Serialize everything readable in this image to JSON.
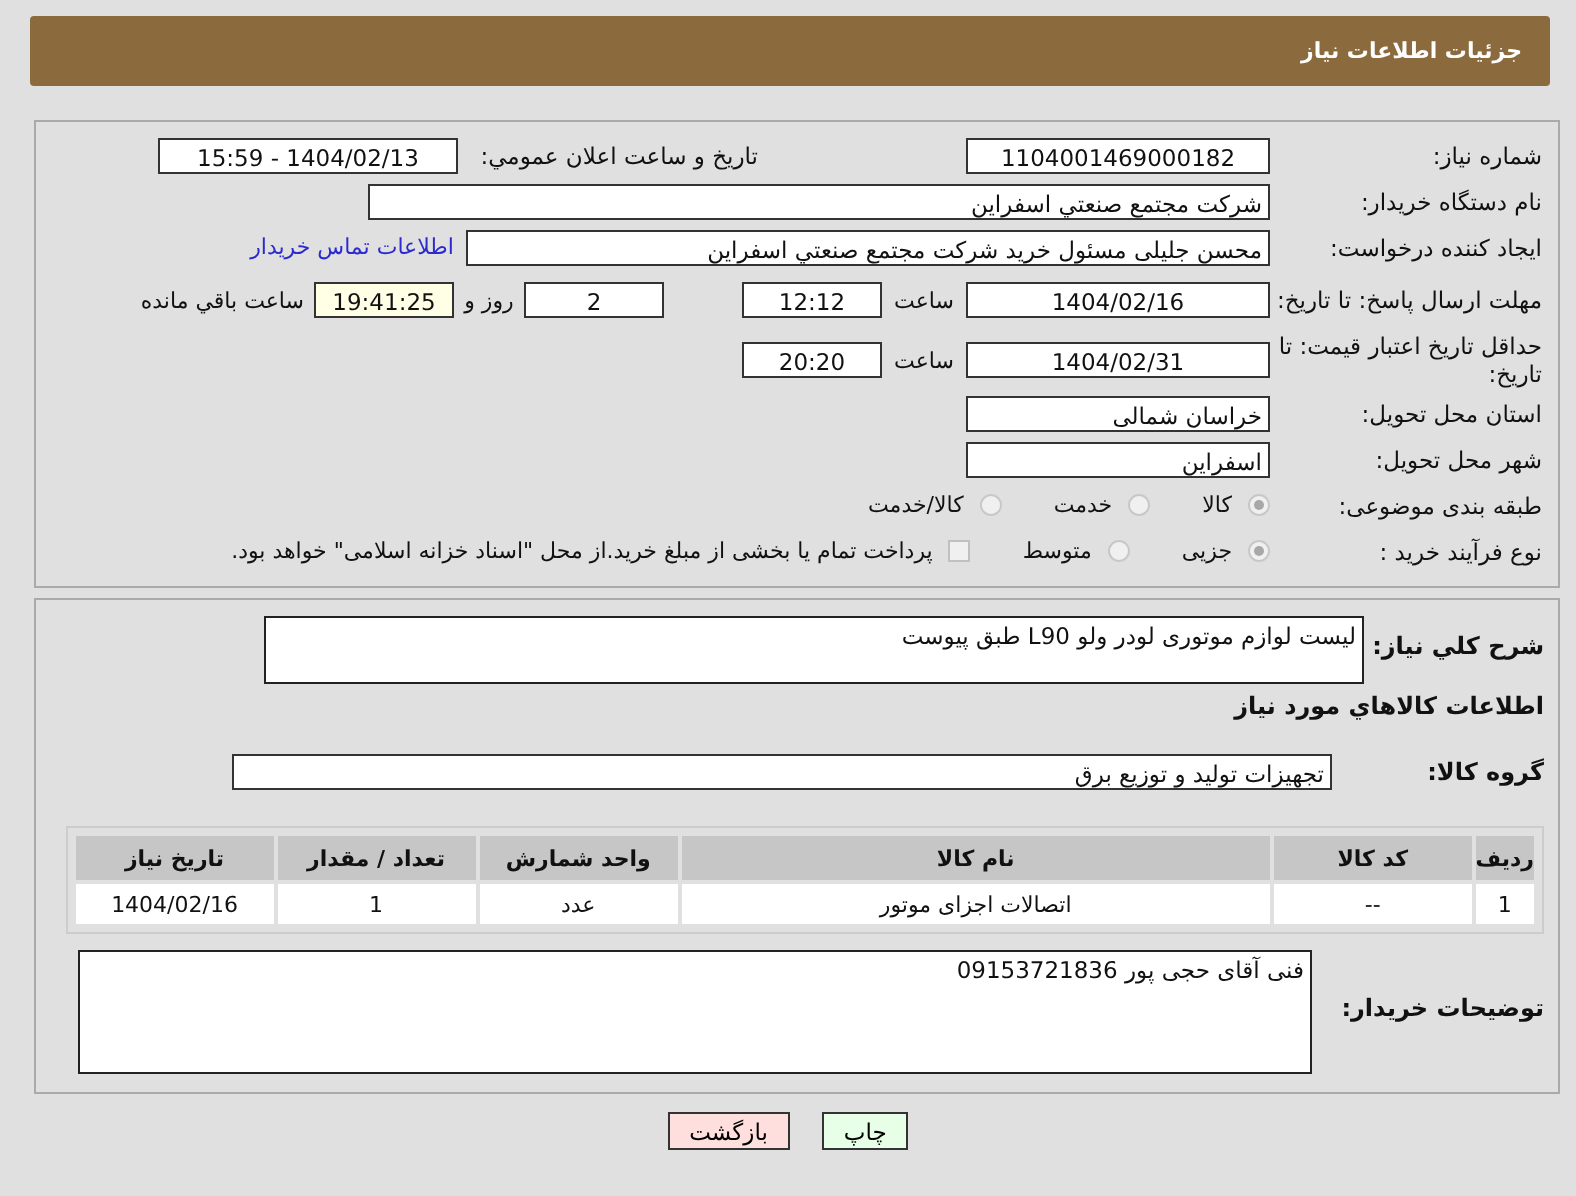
{
  "header": {
    "title": "جزئیات اطلاعات نیاز"
  },
  "need_number": {
    "label": "شماره نیاز:",
    "value": "1104001469000182"
  },
  "announce": {
    "label": "تاریخ و ساعت اعلان عمومي:",
    "value": "1404/02/13 - 15:59"
  },
  "buyer": {
    "label": "نام دستگاه خریدار:",
    "value": "شرکت مجتمع صنعتي اسفراین"
  },
  "requester": {
    "label": "ایجاد کننده درخواست:",
    "value": "محسن جلیلی مسئول خرید شرکت مجتمع صنعتي اسفراین",
    "link": "اطلاعات تماس خریدار"
  },
  "deadline": {
    "label": "مهلت ارسال پاسخ: تا تاریخ:",
    "date": "1404/02/16",
    "time_label": "ساعت",
    "time": "12:12",
    "days": "2",
    "days_label": "روز و",
    "remaining": "19:41:25",
    "remaining_label": "ساعت باقي مانده"
  },
  "validity": {
    "label": "حداقل تاریخ اعتبار قیمت: تا تاریخ:",
    "date": "1404/02/31",
    "time_label": "ساعت",
    "time": "20:20"
  },
  "province": {
    "label": "استان محل تحویل:",
    "value": "خراسان شمالی"
  },
  "city": {
    "label": "شهر محل تحویل:",
    "value": "اسفراین"
  },
  "category": {
    "label": "طبقه بندی موضوعی:",
    "options": [
      {
        "label": "کالا",
        "selected": true
      },
      {
        "label": "خدمت",
        "selected": false
      },
      {
        "label": "کالا/خدمت",
        "selected": false
      }
    ]
  },
  "process": {
    "label": "نوع فرآیند خرید :",
    "options": [
      {
        "label": "جزیی",
        "selected": true
      },
      {
        "label": "متوسط",
        "selected": false
      }
    ],
    "payment": {
      "label": "پرداخت تمام یا بخشی از مبلغ خرید.از محل \"اسناد خزانه اسلامی\" خواهد بود.",
      "checked": false
    }
  },
  "description": {
    "label": "شرح کلي نیاز:",
    "value": "لیست لوازم موتوری لودر ولو L90 طبق پیوست"
  },
  "goods_heading": "اطلاعات کالاهاي مورد نیاز",
  "goods_group": {
    "label": "گروه کالا:",
    "value": "تجهیزات تولید و توزیع برق"
  },
  "table": {
    "columns": [
      "ردیف",
      "کد کالا",
      "نام کالا",
      "واحد شمارش",
      "تعداد / مقدار",
      "تاریخ نیاز"
    ],
    "rows": [
      [
        "1",
        "--",
        "اتصالات اجزای موتور",
        "عدد",
        "1",
        "1404/02/16"
      ]
    ]
  },
  "buyer_notes": {
    "label": "توضیحات خریدار:",
    "value": "فنی آقای حجی پور 09153721836"
  },
  "buttons": [
    {
      "label": "چاپ",
      "kind": "print"
    },
    {
      "label": "بازگشت",
      "kind": "back"
    }
  ]
}
